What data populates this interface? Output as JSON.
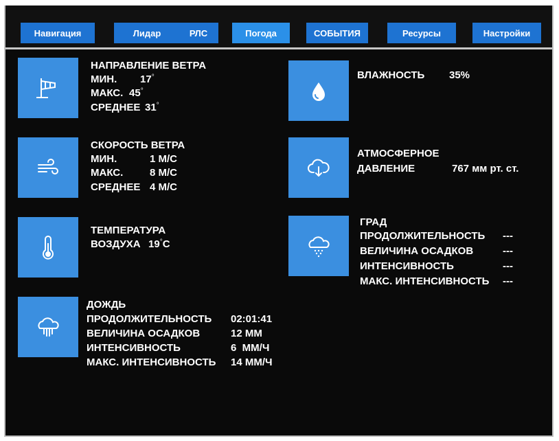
{
  "tabs": [
    {
      "label": "Навигация"
    },
    {
      "label": "Лидар"
    },
    {
      "label": "РЛС"
    },
    {
      "label": "Погода"
    },
    {
      "label": "СОБЫТИЯ"
    },
    {
      "label": "Ресурсы"
    },
    {
      "label": "Настройки"
    }
  ],
  "active_tab": "Погода",
  "colors": {
    "tab": "#1e73d2",
    "tab_active": "#2b90e8",
    "tile": "#3b8fe0",
    "background": "#0a0a0a"
  },
  "wind_direction": {
    "icon": "windsock-icon",
    "title": "НАПРАВЛЕНИЕ ВЕТРА",
    "min_label": "МИН.",
    "min_value": "17",
    "max_label": "МАКС.",
    "max_value": "45",
    "avg_label": "СРЕДНЕЕ",
    "avg_value": "31",
    "degree": "°"
  },
  "wind_speed": {
    "icon": "wind-icon",
    "title": "СКОРОСТЬ ВЕТРА",
    "min_label": "МИН.",
    "min_value": "1 М/С",
    "max_label": "МАКС.",
    "max_value": "8 М/С",
    "avg_label": "СРЕДНЕЕ",
    "avg_value": "4 М/С"
  },
  "temperature": {
    "icon": "thermometer-icon",
    "title": "ТЕМПЕРАТУРА",
    "label": "ВОЗДУХА",
    "value": "19",
    "degree": "°",
    "unit": "C"
  },
  "rain": {
    "icon": "rain-cloud-icon",
    "title": "ДОЖДЬ",
    "duration_label": "ПРОДОЛЖИТЕЛЬНОСТЬ",
    "duration_value": "02:01:41",
    "amount_label": "ВЕЛИЧИНА ОСАДКОВ",
    "amount_value": "12 ММ",
    "intensity_label": "ИНТЕНСИВНОСТЬ",
    "intensity_value": "6  ММ/Ч",
    "max_intensity_label": "МАКС. ИНТЕНСИВНОСТЬ",
    "max_intensity_value": "14 ММ/Ч"
  },
  "humidity": {
    "icon": "water-drop-icon",
    "title": "ВЛАЖНОСТЬ",
    "value": "35%"
  },
  "pressure": {
    "icon": "cloud-download-icon",
    "title_line1": "АТМОСФЕРНОЕ",
    "title_line2": "ДАВЛЕНИЕ",
    "value": "767 мм рт. ст."
  },
  "hail": {
    "icon": "hail-cloud-icon",
    "title": "ГРАД",
    "duration_label": "ПРОДОЛЖИТЕЛЬНОСТЬ",
    "duration_value": "---",
    "amount_label": "ВЕЛИЧИНА ОСАДКОВ",
    "amount_value": "---",
    "intensity_label": "ИНТЕНСИВНОСТЬ",
    "intensity_value": "---",
    "max_intensity_label": "МАКС. ИНТЕНСИВНОСТЬ",
    "max_intensity_value": "---"
  }
}
